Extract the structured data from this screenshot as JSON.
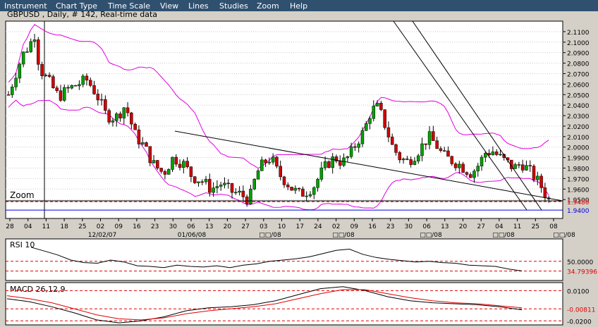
{
  "menu": {
    "items": [
      "Instrument",
      "Chart Type",
      "Time Scale",
      "View",
      "Lines",
      "Studies",
      "Zoom",
      "Help"
    ]
  },
  "main_chart": {
    "title": "GBPUSD , Daily, # 142, Real-time data",
    "zoom_label": "Zoom",
    "price_ticks": [
      "2.1100",
      "2.1000",
      "2.0900",
      "2.0800",
      "2.0700",
      "2.0600",
      "2.0500",
      "2.0400",
      "2.0300",
      "2.0200",
      "2.0100",
      "2.0000",
      "1.9900",
      "1.9800",
      "1.9700",
      "1.9600",
      "1.9500"
    ],
    "price_labels": [
      {
        "text": "1.9480",
        "color": "#e00000"
      },
      {
        "text": "1.9400",
        "color": "#0000e0"
      }
    ],
    "date_ticks": [
      "28",
      "04",
      "11",
      "18",
      "25",
      "02",
      "09",
      "16",
      "23",
      "30",
      "06",
      "13",
      "20",
      "27",
      "03",
      "10",
      "17",
      "24",
      "02",
      "09",
      "16",
      "23",
      "30",
      "06",
      "13",
      "20",
      "27",
      "04",
      "11",
      "25",
      "08"
    ],
    "date_group_labels": [
      "12/02/07",
      "01/06/08",
      "□□/08",
      "□□/08",
      "□□/08",
      "□□/08",
      "□□/08"
    ]
  },
  "rsi": {
    "title": "RSI 10",
    "labels": [
      {
        "text": "50.0000",
        "color": "#000000"
      },
      {
        "text": "34.79396",
        "color": "#e00000"
      }
    ]
  },
  "macd": {
    "title": "MACD 26,12,9",
    "labels": [
      {
        "text": "0.0100",
        "color": "#000000"
      },
      {
        "text": "-0.00811",
        "color": "#e00000"
      },
      {
        "text": "-0.0200",
        "color": "#000000"
      }
    ]
  },
  "chart_data": [
    {
      "type": "candlestick",
      "title": "GBPUSD , Daily, # 142, Real-time data",
      "ylim": [
        1.932,
        2.12
      ],
      "y_ticks": [
        2.11,
        2.1,
        2.09,
        2.08,
        2.07,
        2.06,
        2.05,
        2.04,
        2.03,
        2.02,
        2.01,
        2.0,
        1.99,
        1.98,
        1.97,
        1.96,
        1.95
      ],
      "close_points": [
        [
          0,
          2.05
        ],
        [
          6,
          2.07
        ],
        [
          12,
          2.088
        ],
        [
          18,
          2.098
        ],
        [
          22,
          2.108
        ],
        [
          26,
          2.075
        ],
        [
          34,
          2.062
        ],
        [
          42,
          2.048
        ],
        [
          50,
          2.055
        ],
        [
          58,
          2.06
        ],
        [
          66,
          2.064
        ],
        [
          74,
          2.05
        ],
        [
          82,
          2.03
        ],
        [
          90,
          2.028
        ],
        [
          98,
          2.04
        ],
        [
          106,
          2.012
        ],
        [
          114,
          2.0
        ],
        [
          122,
          1.983
        ],
        [
          130,
          1.975
        ],
        [
          138,
          1.99
        ],
        [
          146,
          1.985
        ],
        [
          154,
          1.972
        ],
        [
          162,
          1.968
        ],
        [
          170,
          1.96
        ],
        [
          178,
          1.965
        ],
        [
          186,
          1.958
        ],
        [
          194,
          1.955
        ],
        [
          202,
          1.95
        ],
        [
          208,
          1.975
        ],
        [
          214,
          1.985
        ],
        [
          220,
          1.99
        ],
        [
          226,
          1.975
        ],
        [
          232,
          1.968
        ],
        [
          238,
          1.96
        ],
        [
          244,
          1.955
        ],
        [
          250,
          1.958
        ],
        [
          256,
          1.963
        ],
        [
          262,
          1.975
        ],
        [
          268,
          1.985
        ],
        [
          274,
          1.99
        ],
        [
          280,
          1.985
        ],
        [
          286,
          1.992
        ],
        [
          292,
          2.005
        ],
        [
          298,
          2.015
        ],
        [
          304,
          2.035
        ],
        [
          310,
          2.038
        ],
        [
          316,
          2.02
        ],
        [
          322,
          2.0
        ],
        [
          328,
          1.99
        ],
        [
          334,
          1.986
        ],
        [
          340,
          1.992
        ],
        [
          346,
          2.0
        ],
        [
          352,
          2.01
        ],
        [
          358,
          2.003
        ],
        [
          364,
          1.992
        ],
        [
          370,
          1.988
        ],
        [
          376,
          1.985
        ],
        [
          382,
          1.98
        ],
        [
          388,
          1.975
        ],
        [
          394,
          1.983
        ],
        [
          400,
          1.995
        ],
        [
          406,
          1.996
        ],
        [
          412,
          1.99
        ],
        [
          418,
          1.985
        ],
        [
          424,
          1.98
        ],
        [
          430,
          1.985
        ],
        [
          436,
          1.978
        ],
        [
          442,
          1.97
        ],
        [
          448,
          1.96
        ],
        [
          452,
          1.95
        ],
        [
          456,
          1.948
        ]
      ],
      "horizontal_levels": [
        {
          "value": 1.948,
          "color": "#e00000",
          "style": "dashed"
        },
        {
          "value": 1.94,
          "color": "#0000e0",
          "style": "solid"
        }
      ]
    },
    {
      "type": "line",
      "title": "RSI 10",
      "ylim": [
        20,
        85
      ],
      "levels": [
        50.0,
        34.79396
      ],
      "values": [
        72,
        66,
        60,
        52,
        48,
        47,
        52,
        49,
        43,
        42,
        40,
        44,
        42,
        41,
        43,
        40,
        44,
        46,
        50,
        52,
        54,
        57,
        62,
        67,
        69,
        61,
        56,
        53,
        51,
        49,
        50,
        48,
        47,
        44,
        43,
        42,
        38,
        35
      ]
    },
    {
      "type": "line",
      "title": "MACD 26,12,9",
      "ylim": [
        -0.024,
        0.018
      ],
      "levels": [
        0.01,
        -0.00811,
        -0.02
      ],
      "series": [
        {
          "values": [
            0.002,
            -0.001,
            -0.006,
            -0.012,
            -0.019,
            -0.022,
            -0.02,
            -0.016,
            -0.01,
            -0.007,
            -0.006,
            -0.004,
            0.0,
            0.006,
            0.012,
            0.014,
            0.01,
            0.004,
            0.0,
            -0.002,
            -0.003,
            -0.004,
            -0.006,
            -0.009
          ],
          "color": "#000000"
        },
        {
          "values": [
            0.005,
            0.002,
            -0.002,
            -0.008,
            -0.014,
            -0.018,
            -0.019,
            -0.017,
            -0.013,
            -0.01,
            -0.008,
            -0.006,
            -0.003,
            0.002,
            0.007,
            0.011,
            0.011,
            0.007,
            0.003,
            0.0,
            -0.002,
            -0.003,
            -0.005,
            -0.007
          ],
          "color": "#e00000"
        }
      ]
    }
  ]
}
